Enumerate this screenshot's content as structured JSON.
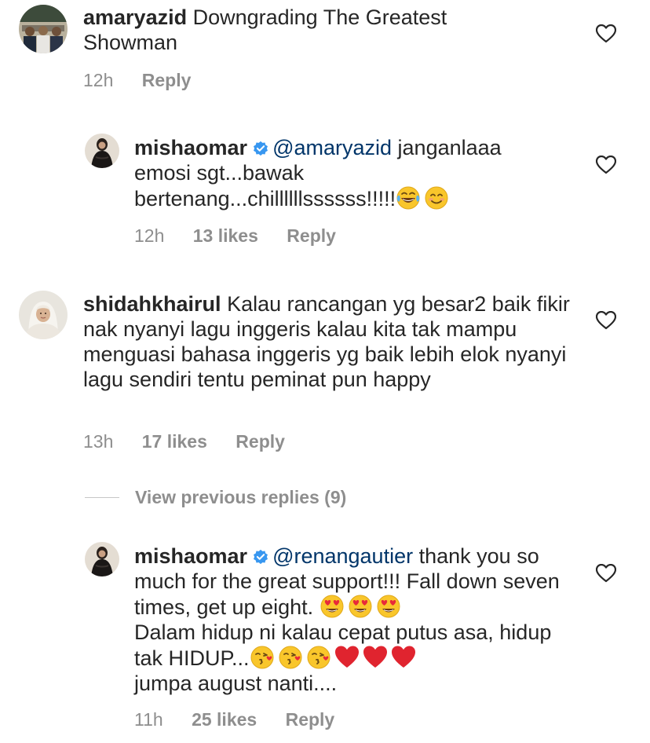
{
  "comments": [
    {
      "username": "amaryazid",
      "text": "Downgrading The Greatest Showman",
      "time": "12h",
      "reply": "Reply"
    },
    {
      "username": "mishaomar",
      "mention": "@amaryazid",
      "text": "janganlaaa emosi sgt...bawak bertenang...chillllllssssss!!!!!",
      "emojis": [
        "tears-of-joy-emoji",
        "smiling-face-emoji"
      ],
      "time": "12h",
      "likes": "13 likes",
      "reply": "Reply"
    },
    {
      "username": "shidahkhairul",
      "text": "Kalau rancangan yg besar2 baik fikir nak nyanyi lagu inggeris kalau kita tak mampu menguasi bahasa inggeris yg baik lebih elok nyanyi lagu sendiri tentu peminat pun happy",
      "time": "13h",
      "likes": "17 likes",
      "reply": "Reply"
    },
    {
      "username": "mishaomar",
      "mention": "@renangautier",
      "text1": "thank you so much for the great support!!! Fall down seven times, get up eight.",
      "text2": "Dalam hidup ni kalau cepat putus asa, hidup tak HIDUP...",
      "text3": "jumpa august nanti....",
      "emojis1": [
        "heart-eyes-emoji",
        "heart-eyes-emoji",
        "heart-eyes-emoji"
      ],
      "emojis2": [
        "kissing-heart-emoji",
        "kissing-heart-emoji",
        "kissing-heart-emoji",
        "red-heart-emoji",
        "red-heart-emoji",
        "red-heart-emoji"
      ],
      "time": "11h",
      "likes": "25 likes",
      "reply": "Reply"
    }
  ],
  "view_previous_replies": "View previous replies (9)",
  "colors": {
    "text": "#262626",
    "meta": "#8e8e8e",
    "mention": "#003569",
    "verified": "#3897f0"
  }
}
